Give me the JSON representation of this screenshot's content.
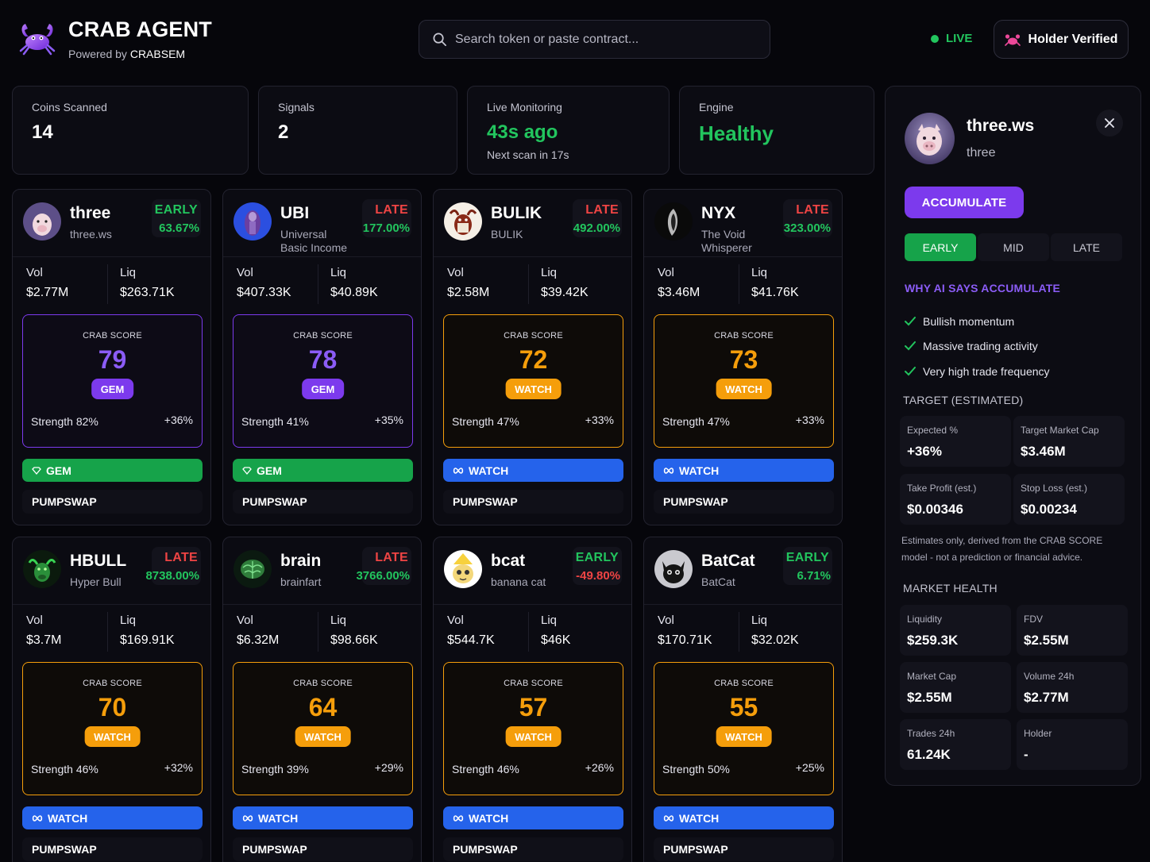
{
  "header": {
    "brand": "CRAB AGENT",
    "powered_prefix": "Powered by",
    "powered_name": "CRABSEM",
    "search_placeholder": "Search token or paste contract...",
    "live_label": "LIVE",
    "holder_label": "Holder Verified"
  },
  "stats": {
    "coins_scanned": {
      "label": "Coins Scanned",
      "value": "14"
    },
    "signals": {
      "label": "Signals",
      "value": "2"
    },
    "monitoring": {
      "label": "Live Monitoring",
      "value": "43s ago",
      "sub": "Next scan in 17s"
    },
    "engine": {
      "label": "Engine",
      "value": "Healthy"
    }
  },
  "labels": {
    "vol": "Vol",
    "liq": "Liq",
    "crab_score": "CRAB SCORE",
    "strength_prefix": "Strength"
  },
  "coins": [
    {
      "name": "three",
      "sub": "three.ws",
      "phase": "EARLY",
      "pct": "63.67%",
      "vol": "$2.77M",
      "liq": "$263.71K",
      "score": "79",
      "badge": "GEM",
      "strength": "82%",
      "upside": "+36%",
      "action": "GEM",
      "dex": "PUMPSWAP",
      "avatar": "pig"
    },
    {
      "name": "UBI",
      "sub": "Universal Basic Income",
      "phase": "LATE",
      "pct": "177.00%",
      "vol": "$407.33K",
      "liq": "$40.89K",
      "score": "78",
      "badge": "GEM",
      "strength": "41%",
      "upside": "+35%",
      "action": "GEM",
      "dex": "PUMPSWAP",
      "avatar": "statue"
    },
    {
      "name": "BULIK",
      "sub": "BULIK",
      "phase": "LATE",
      "pct": "492.00%",
      "vol": "$2.58M",
      "liq": "$39.42K",
      "score": "72",
      "badge": "WATCH",
      "strength": "47%",
      "upside": "+33%",
      "action": "WATCH",
      "dex": "PUMPSWAP",
      "avatar": "bull"
    },
    {
      "name": "NYX",
      "sub": "The Void Whisperer",
      "phase": "LATE",
      "pct": "323.00%",
      "vol": "$3.46M",
      "liq": "$41.76K",
      "score": "73",
      "badge": "WATCH",
      "strength": "47%",
      "upside": "+33%",
      "action": "WATCH",
      "dex": "PUMPSWAP",
      "avatar": "shadow"
    },
    {
      "name": "HBULL",
      "sub": "Hyper Bull",
      "phase": "LATE",
      "pct": "8738.00%",
      "vol": "$3.7M",
      "liq": "$169.91K",
      "score": "70",
      "badge": "WATCH",
      "strength": "46%",
      "upside": "+32%",
      "action": "WATCH",
      "dex": "PUMPSWAP",
      "avatar": "greenbull"
    },
    {
      "name": "brain",
      "sub": "brainfart",
      "phase": "LATE",
      "pct": "3766.00%",
      "vol": "$6.32M",
      "liq": "$98.66K",
      "score": "64",
      "badge": "WATCH",
      "strength": "39%",
      "upside": "+29%",
      "action": "WATCH",
      "dex": "PUMPSWAP",
      "avatar": "brain"
    },
    {
      "name": "bcat",
      "sub": "banana cat",
      "phase": "EARLY",
      "pct": "-49.80%",
      "vol": "$544.7K",
      "liq": "$46K",
      "score": "57",
      "badge": "WATCH",
      "strength": "46%",
      "upside": "+26%",
      "action": "WATCH",
      "dex": "PUMPSWAP",
      "avatar": "bananacat"
    },
    {
      "name": "BatCat",
      "sub": "BatCat",
      "phase": "EARLY",
      "pct": "6.71%",
      "vol": "$170.71K",
      "liq": "$32.02K",
      "score": "55",
      "badge": "WATCH",
      "strength": "50%",
      "upside": "+25%",
      "action": "WATCH",
      "dex": "PUMPSWAP",
      "avatar": "batcat"
    }
  ],
  "panel": {
    "name": "three.ws",
    "symbol": "three",
    "signal": "ACCUMULATE",
    "tabs": [
      "EARLY",
      "MID",
      "LATE"
    ],
    "active_tab": "EARLY",
    "why_title": "WHY AI SAYS ACCUMULATE",
    "reasons": [
      "Bullish momentum",
      "Massive trading activity",
      "Very high trade frequency"
    ],
    "target_title": "TARGET (ESTIMATED)",
    "expected": {
      "label": "Expected %",
      "value": "+36%"
    },
    "target_mcap": {
      "label": "Target Market Cap",
      "value": "$3.46M"
    },
    "take_profit": {
      "label": "Take Profit (est.)",
      "value": "$0.00346"
    },
    "stop_loss": {
      "label": "Stop Loss (est.)",
      "value": "$0.00234"
    },
    "disclaimer": "Estimates only, derived from the CRAB SCORE model - not a prediction or financial advice.",
    "health_title": "MARKET HEALTH",
    "liquidity": {
      "label": "Liquidity",
      "value": "$259.3K"
    },
    "fdv": {
      "label": "FDV",
      "value": "$2.55M"
    },
    "market_cap": {
      "label": "Market Cap",
      "value": "$2.55M"
    },
    "volume24": {
      "label": "Volume 24h",
      "value": "$2.77M"
    },
    "trades24": {
      "label": "Trades 24h",
      "value": "61.24K"
    },
    "holder": {
      "label": "Holder",
      "value": "-"
    }
  },
  "colors": {
    "accent_violet": "#7c3aed",
    "gem_green": "#16a34a",
    "watch_blue": "#2563eb",
    "watch_orange": "#f59e0b",
    "positive": "#22c55e",
    "negative": "#ef4444"
  }
}
